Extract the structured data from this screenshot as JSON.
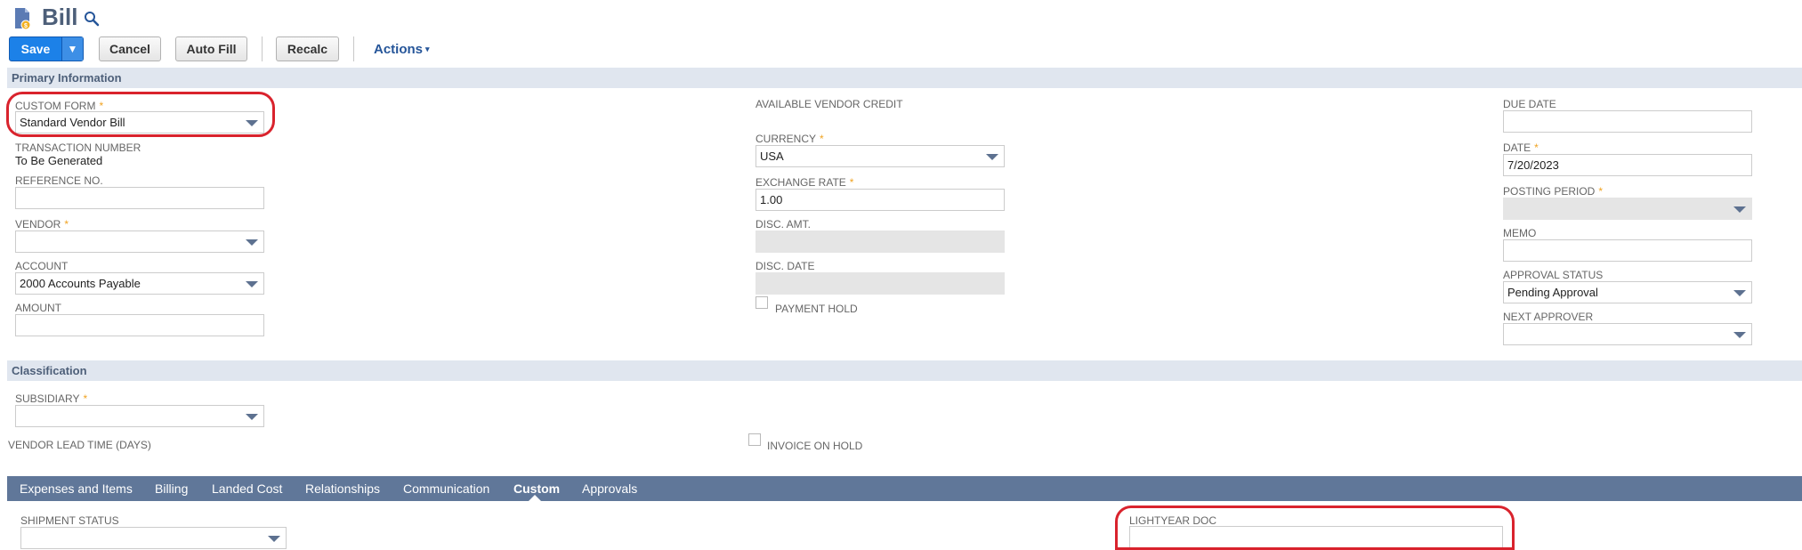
{
  "header": {
    "title": "Bill",
    "doc_icon": "document-icon",
    "search_icon": "search-icon"
  },
  "toolbar": {
    "save_label": "Save",
    "save_menu_glyph": "▼",
    "cancel_label": "Cancel",
    "autofill_label": "Auto Fill",
    "recalc_label": "Recalc",
    "actions_label": "Actions",
    "actions_caret": "▾"
  },
  "primary": {
    "section_label": "Primary Information",
    "custom_form": {
      "label": "CUSTOM FORM",
      "required": "*",
      "value": "Standard Vendor Bill"
    },
    "transaction_number": {
      "label": "TRANSACTION NUMBER",
      "value": "To Be Generated"
    },
    "reference_no": {
      "label": "REFERENCE NO.",
      "value": ""
    },
    "vendor": {
      "label": "VENDOR",
      "required": "*",
      "value": ""
    },
    "account": {
      "label": "ACCOUNT",
      "value": "2000 Accounts Payable"
    },
    "amount": {
      "label": "AMOUNT",
      "value": ""
    },
    "available_vendor_credit": {
      "label": "AVAILABLE VENDOR CREDIT"
    },
    "currency": {
      "label": "CURRENCY",
      "required": "*",
      "value": "USA"
    },
    "exchange_rate": {
      "label": "EXCHANGE RATE",
      "required": "*",
      "value": "1.00"
    },
    "disc_amt": {
      "label": "DISC. AMT.",
      "value": ""
    },
    "disc_date": {
      "label": "DISC. DATE",
      "value": ""
    },
    "payment_hold": {
      "label": "PAYMENT HOLD",
      "checked": false
    },
    "due_date": {
      "label": "DUE DATE",
      "value": ""
    },
    "date": {
      "label": "DATE",
      "required": "*",
      "value": "7/20/2023"
    },
    "posting_period": {
      "label": "POSTING PERIOD",
      "required": "*",
      "value": ""
    },
    "memo": {
      "label": "MEMO",
      "value": ""
    },
    "approval_status": {
      "label": "APPROVAL STATUS",
      "value": "Pending Approval"
    },
    "next_approver": {
      "label": "NEXT APPROVER",
      "value": ""
    }
  },
  "classification": {
    "section_label": "Classification",
    "subsidiary": {
      "label": "SUBSIDIARY",
      "required": "*",
      "value": ""
    },
    "vendor_lead_time": {
      "label": "VENDOR LEAD TIME (DAYS)"
    },
    "invoice_on_hold": {
      "label": "INVOICE ON HOLD",
      "checked": false
    }
  },
  "subtabs": {
    "tabs": [
      "Expenses and Items",
      "Billing",
      "Landed Cost",
      "Relationships",
      "Communication",
      "Custom",
      "Approvals"
    ],
    "active": "Custom"
  },
  "custom_tab": {
    "shipment_status": {
      "label": "SHIPMENT STATUS",
      "value": ""
    },
    "lightyear_doc": {
      "label": "LIGHTYEAR DOC",
      "value": ""
    }
  },
  "colors": {
    "primary_button": "#1c81e8",
    "section_bar": "#e0e6ef",
    "tab_bar": "#607799",
    "required_marker": "#f0a322",
    "callout": "#d9232d",
    "title": "#4d5f79"
  }
}
